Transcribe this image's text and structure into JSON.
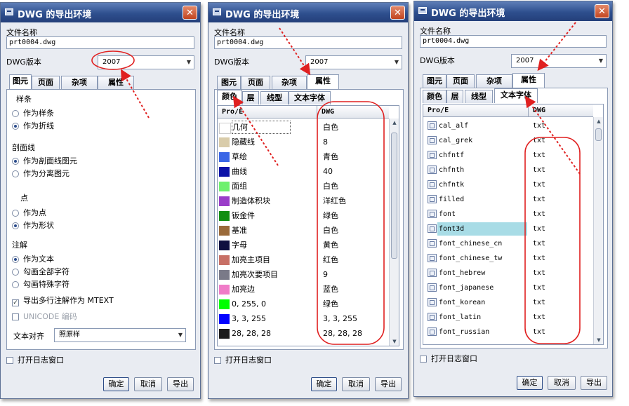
{
  "common": {
    "title": "DWG 的导出环境",
    "close": "✕",
    "file_label": "文件名称",
    "file_value": "prt0004.dwg",
    "version_label": "DWG版本",
    "version_value": "2007",
    "tabs": [
      "图元",
      "页面",
      "杂项",
      "属性"
    ],
    "log_label": "打开日志窗口",
    "ok": "确定",
    "cancel": "取消",
    "export": "导出"
  },
  "dialog1": {
    "spline_label": "样条",
    "spline_opts": [
      "作为样条",
      "作为折线"
    ],
    "hatch_label": "剖面线",
    "hatch_opts": [
      "作为剖面线图元",
      "作为分离图元"
    ],
    "point_label": "点",
    "point_opts": [
      "作为点",
      "作为形状"
    ],
    "note_label": "注解",
    "note_opts": [
      "作为文本",
      "勾画全部字符",
      "勾画特殊字符"
    ],
    "mtext_label": "导出多行注解作为 MTEXT",
    "unicode_label": "UNICODE 编码",
    "align_label": "文本对齐",
    "align_value": "照原样"
  },
  "subtabs": [
    "颜色",
    "层",
    "线型",
    "文本字体"
  ],
  "dialog2": {
    "col1": "Pro/E",
    "col2": "DWG",
    "rows": [
      {
        "name": "几何",
        "value": "白色",
        "color": "#ffffff"
      },
      {
        "name": "隐藏线",
        "value": "8",
        "color": "#d9ccaa"
      },
      {
        "name": "草绘",
        "value": "青色",
        "color": "#3a66e6"
      },
      {
        "name": "曲线",
        "value": "40",
        "color": "#0c12a8"
      },
      {
        "name": "面组",
        "value": "白色",
        "color": "#6ef06e"
      },
      {
        "name": "制造体积块",
        "value": "洋红色",
        "color": "#9a3dc9"
      },
      {
        "name": "钣金件",
        "value": "绿色",
        "color": "#128e12"
      },
      {
        "name": "基准",
        "value": "白色",
        "color": "#9a6a3a"
      },
      {
        "name": "字母",
        "value": "黄色",
        "color": "#101040"
      },
      {
        "name": "加亮主项目",
        "value": "红色",
        "color": "#c87066"
      },
      {
        "name": "加亮次要项目",
        "value": "9",
        "color": "#7a7a88"
      },
      {
        "name": "加亮边",
        "value": "蓝色",
        "color": "#f07cc8"
      },
      {
        "name": "0, 255, 0",
        "value": "绿色",
        "color": "#00ff00"
      },
      {
        "name": "3, 3, 255",
        "value": "3, 3, 255",
        "color": "#0303ff"
      },
      {
        "name": "28, 28, 28",
        "value": "28, 28, 28",
        "color": "#1c1c1c"
      }
    ]
  },
  "dialog3": {
    "col1": "Pro/E",
    "col2": "DWG",
    "rows": [
      {
        "name": "cal_alf",
        "value": "txt"
      },
      {
        "name": "cal_grek",
        "value": "txt"
      },
      {
        "name": "chfntf",
        "value": "txt"
      },
      {
        "name": "chfnth",
        "value": "txt"
      },
      {
        "name": "chfntk",
        "value": "txt"
      },
      {
        "name": "filled",
        "value": "txt"
      },
      {
        "name": "font",
        "value": "txt"
      },
      {
        "name": "font3d",
        "value": "txt"
      },
      {
        "name": "font_chinese_cn",
        "value": "txt"
      },
      {
        "name": "font_chinese_tw",
        "value": "txt"
      },
      {
        "name": "font_hebrew",
        "value": "txt"
      },
      {
        "name": "font_japanese",
        "value": "txt"
      },
      {
        "name": "font_korean",
        "value": "txt"
      },
      {
        "name": "font_latin",
        "value": "txt"
      },
      {
        "name": "font_russian",
        "value": "txt"
      }
    ]
  }
}
